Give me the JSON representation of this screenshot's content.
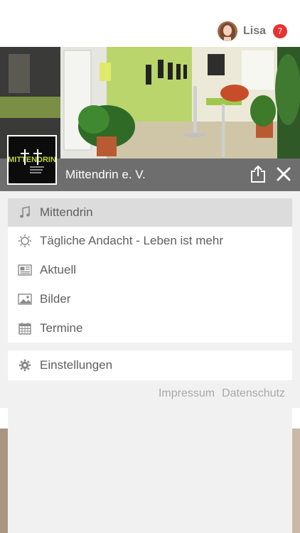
{
  "header": {
    "user_name": "Lisa",
    "notification_count": "7"
  },
  "organization": {
    "title": "Mittendrin e. V.",
    "logo_text": "MITTENDRIN"
  },
  "menu": {
    "items": [
      {
        "label": "Mittendrin",
        "icon": "music-note-icon",
        "active": true
      },
      {
        "label": "Tägliche Andacht - Leben ist mehr",
        "icon": "sun-icon",
        "active": false
      },
      {
        "label": "Aktuell",
        "icon": "newspaper-icon",
        "active": false
      },
      {
        "label": "Bilder",
        "icon": "image-icon",
        "active": false
      },
      {
        "label": "Termine",
        "icon": "calendar-icon",
        "active": false
      }
    ],
    "settings_label": "Einstellungen"
  },
  "footer": {
    "impressum": "Impressum",
    "datenschutz": "Datenschutz"
  },
  "colors": {
    "titlebar": "#6e6e6e",
    "badge": "#e53232",
    "active_item": "#dcdcdc"
  }
}
